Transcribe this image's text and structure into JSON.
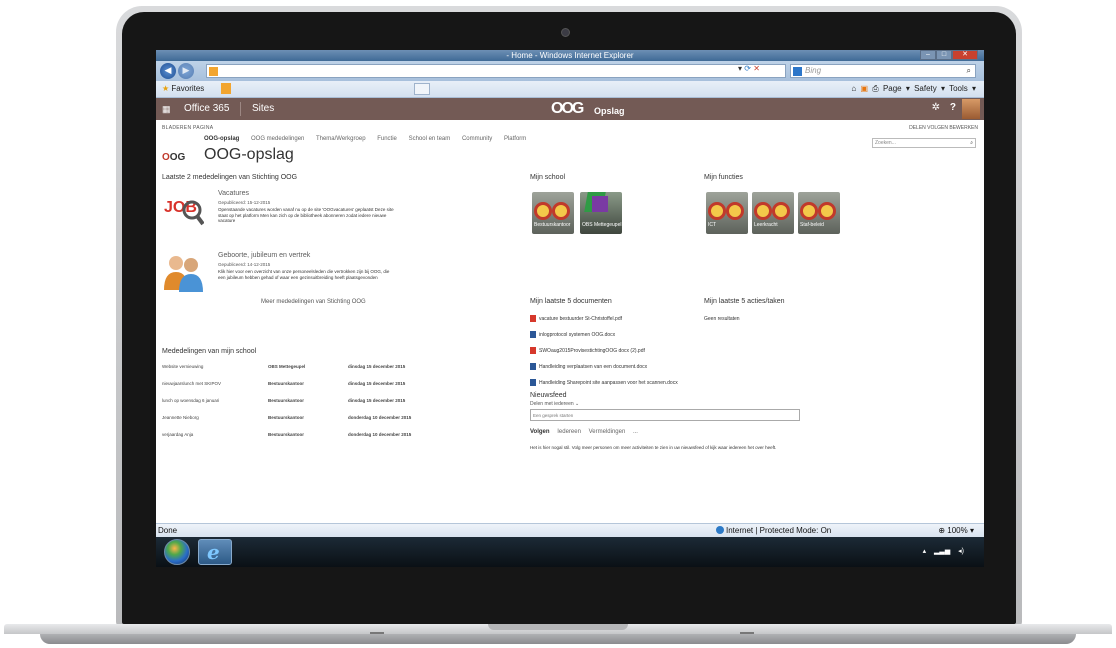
{
  "browser": {
    "title": "- Home - Windows Internet Explorer",
    "search_placeholder": "Bing",
    "favorites_label": "Favorites",
    "toolbar_right": "Page ▾  Safety ▾  Tools ▾"
  },
  "o365": {
    "app_label": "Office 365",
    "sites_label": "Sites",
    "logo": "OOG",
    "logo_sub": "Opslag"
  },
  "ribbon": {
    "left": "BLADEREN   PAGINA",
    "right": "DELEN   VOLGEN   BEWERKEN"
  },
  "site": {
    "nav": [
      "OOG-opslag",
      "OOG mededelingen",
      "Thema/Werkgroep",
      "Functie",
      "School en team",
      "Community",
      "Platform"
    ],
    "title": "OOG-opslag",
    "search_placeholder": "Zoeken..."
  },
  "announcements": {
    "heading": "Laatste 2 mededelingen van Stichting OOG",
    "items": [
      {
        "title": "Vacatures",
        "date": "Gepubliceerd: 15-12-2015",
        "body": "Openstaande vacatures worden vanaf nu op de site 'OOGvacatures' geplaatst Deze site staat op het platform Men kan zich op de bibliotheek abonneren zodat iedere nieuwe vacature"
      },
      {
        "title": "Geboorte, jubileum en vertrek",
        "date": "Gepubliceerd: 14-12-2015",
        "body": "Klik hier voor een overzicht van onze personeelsleden die vertrokken zijn bij OOG, die een jubileum hebben gehad of waar een gezinsuitbreiding heeft plaatsgevonden"
      }
    ],
    "more_link": "Meer mededelingen van Stichting OOG"
  },
  "school_news": {
    "heading": "Mededelingen van mijn school",
    "rows": [
      [
        "Website vernieuwing",
        "OBS Mettegeupel",
        "dinsdag 15 december 2015"
      ],
      [
        "nieuwjaarslunch met SKIPOV",
        "Bestuurskantoor",
        "dinsdag 15 december 2015"
      ],
      [
        "lunch op woensdag 6 januari",
        "Bestuurskantoor",
        "dinsdag 15 december 2015"
      ],
      [
        "Jeannette Nieborg",
        "Bestuurskantoor",
        "donderdag 10 december 2015"
      ],
      [
        "verjaardag Anja",
        "Bestuurskantoor",
        "donderdag 10 december 2015"
      ]
    ]
  },
  "my_school": {
    "heading": "Mijn school",
    "tiles": [
      "Bestuurskantoor",
      "OBS Mettegeupel"
    ]
  },
  "my_functions": {
    "heading": "Mijn functies",
    "tiles": [
      "ICT",
      "Leerkracht",
      "Staf-beleid"
    ]
  },
  "documents": {
    "heading": "Mijn laatste 5 documenten",
    "items": [
      {
        "name": "vacature bestuurder St-Christoffel.pdf",
        "type": "pdf"
      },
      {
        "name": "inlogprotocol systemen OOG.docx",
        "type": "word"
      },
      {
        "name": "SWOaug2015ProvisestichtingOOG docx (2).pdf",
        "type": "pdf"
      },
      {
        "name": "Handleiding verplaatsen van een document.docx",
        "type": "word"
      },
      {
        "name": "Handleiding Sharepoint site aanpassen voor het scannen.docx",
        "type": "word"
      }
    ]
  },
  "tasks": {
    "heading": "Mijn laatste 5 acties/taken",
    "empty": "Geen resultaten"
  },
  "newsfeed": {
    "heading": "Nieuwsfeed",
    "share": "Delen met iedereen ⌄",
    "input_placeholder": "Een gesprek starten",
    "tabs": [
      "Volgen",
      "Iedereen",
      "Vermeldingen",
      "..."
    ],
    "message": "Het is hier nogal stil. Volg meer personen om meer activiteiten te zien in uw nieuwsfeed of kijk waar iedereen het over heeft."
  },
  "status": {
    "done": "Done",
    "zone": "Internet | Protected Mode: On",
    "zoom": "100%"
  },
  "colors": {
    "suite_bar": "#735a55",
    "accent_red": "#c0392b",
    "ie_blue": "#3f6a96"
  }
}
